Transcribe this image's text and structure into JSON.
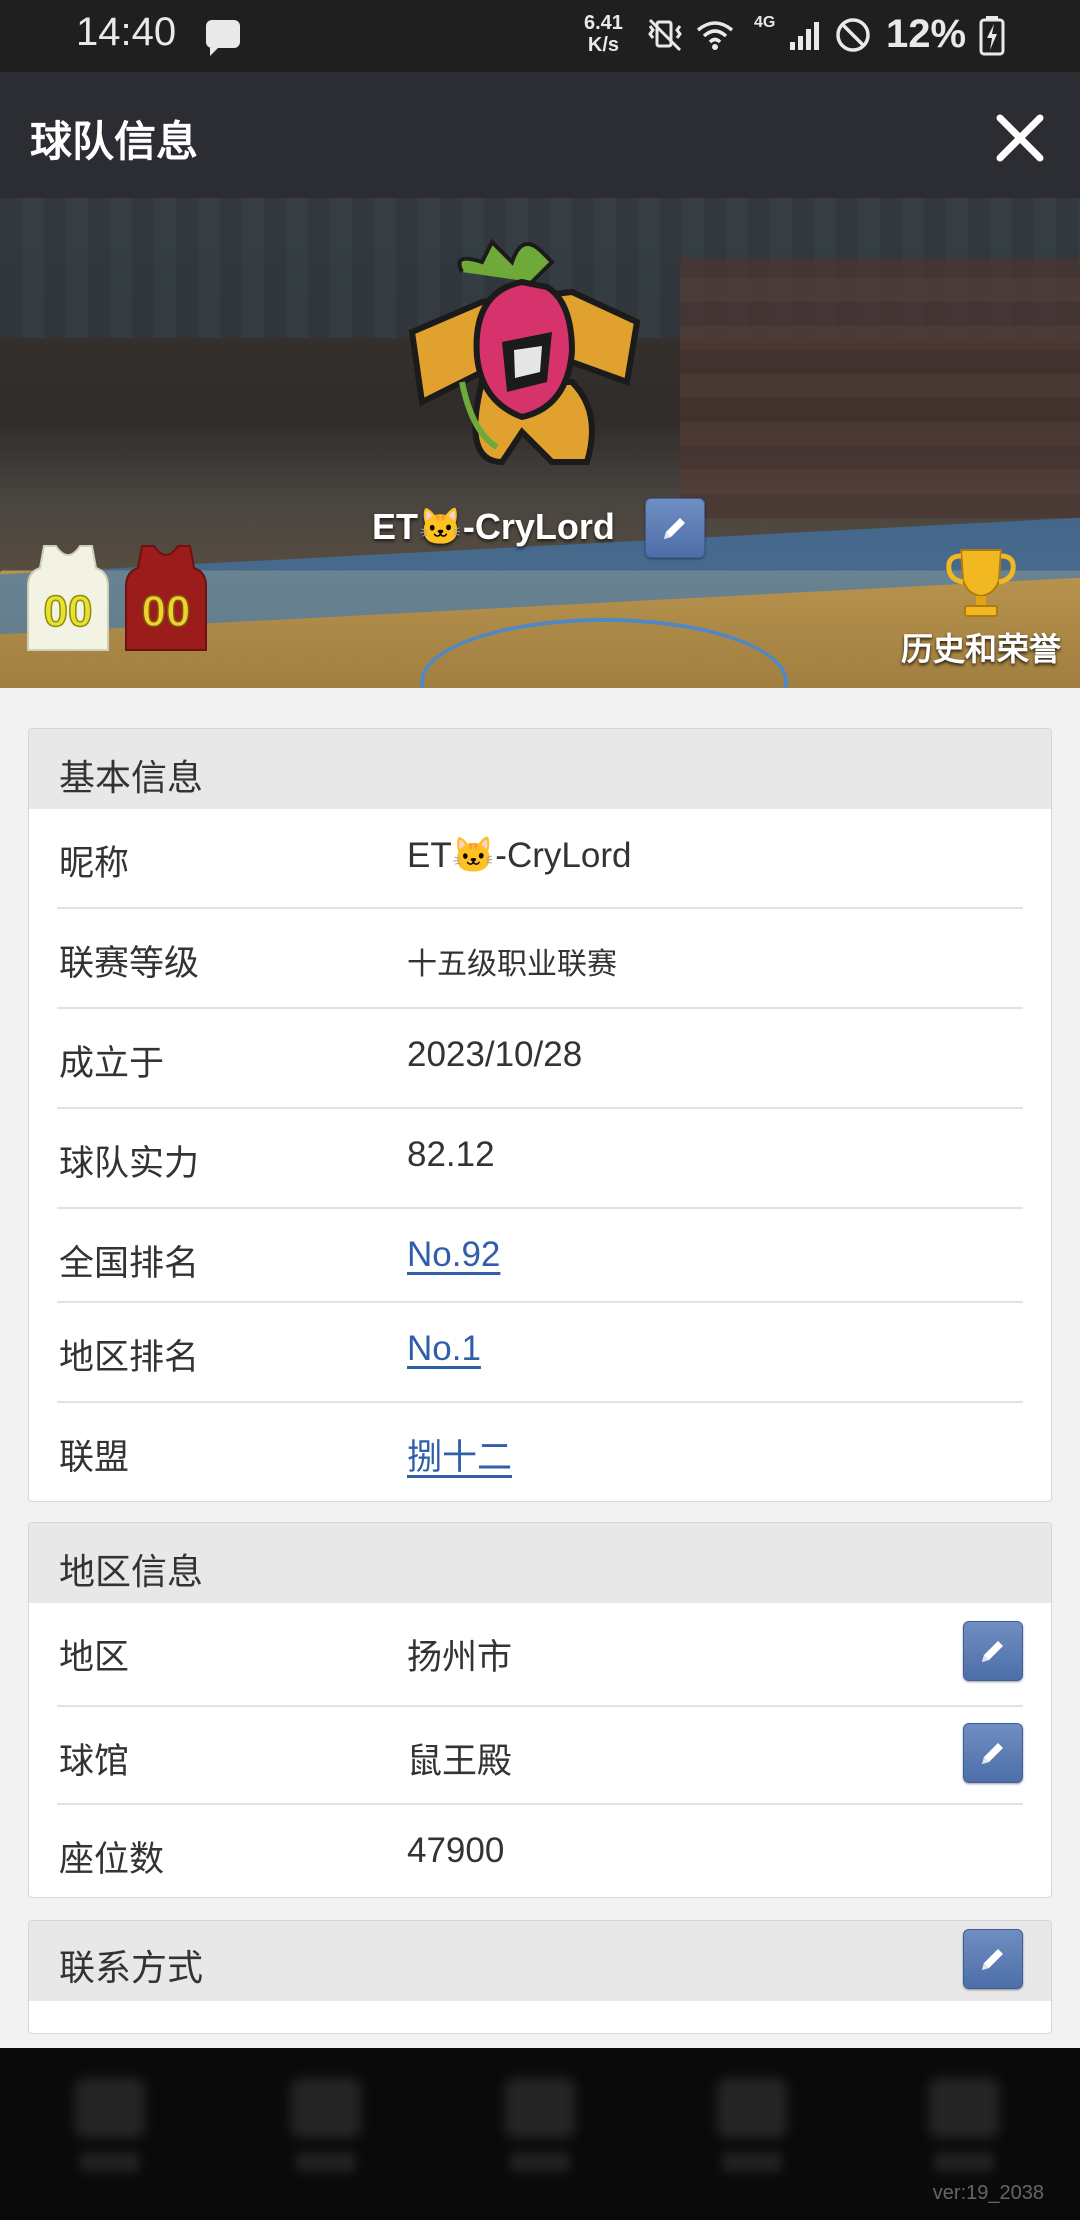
{
  "status_bar": {
    "time": "14:40",
    "net_speed_value": "6.41",
    "net_speed_unit": "K/s",
    "network": "4G",
    "battery": "12%"
  },
  "header": {
    "title": "球队信息"
  },
  "team": {
    "name": "ET🐱-CryLord",
    "home_jersey_number": "00",
    "away_jersey_number": "00",
    "honor_label": "历史和荣誉"
  },
  "basic_info": {
    "title": "基本信息",
    "rows": [
      {
        "label": "昵称",
        "value": "ET🐱-CryLord"
      },
      {
        "label": "联赛等级",
        "value": "十五级职业联赛"
      },
      {
        "label": "成立于",
        "value": "2023/10/28"
      },
      {
        "label": "球队实力",
        "value": "82.12"
      },
      {
        "label": "全国排名",
        "value": "No.92"
      },
      {
        "label": "地区排名",
        "value": "No.1"
      },
      {
        "label": "联盟",
        "value": "捌十二"
      }
    ]
  },
  "region_info": {
    "title": "地区信息",
    "rows": [
      {
        "label": "地区",
        "value": "扬州市"
      },
      {
        "label": "球馆",
        "value": "鼠王殿"
      },
      {
        "label": "座位数",
        "value": "47900"
      }
    ]
  },
  "contact": {
    "title": "联系方式"
  },
  "footer": {
    "version": "ver:19_2038"
  },
  "colors": {
    "link": "#2f5fa8",
    "edit_button": "#5677b0",
    "title_bar": "#2b2d33"
  }
}
